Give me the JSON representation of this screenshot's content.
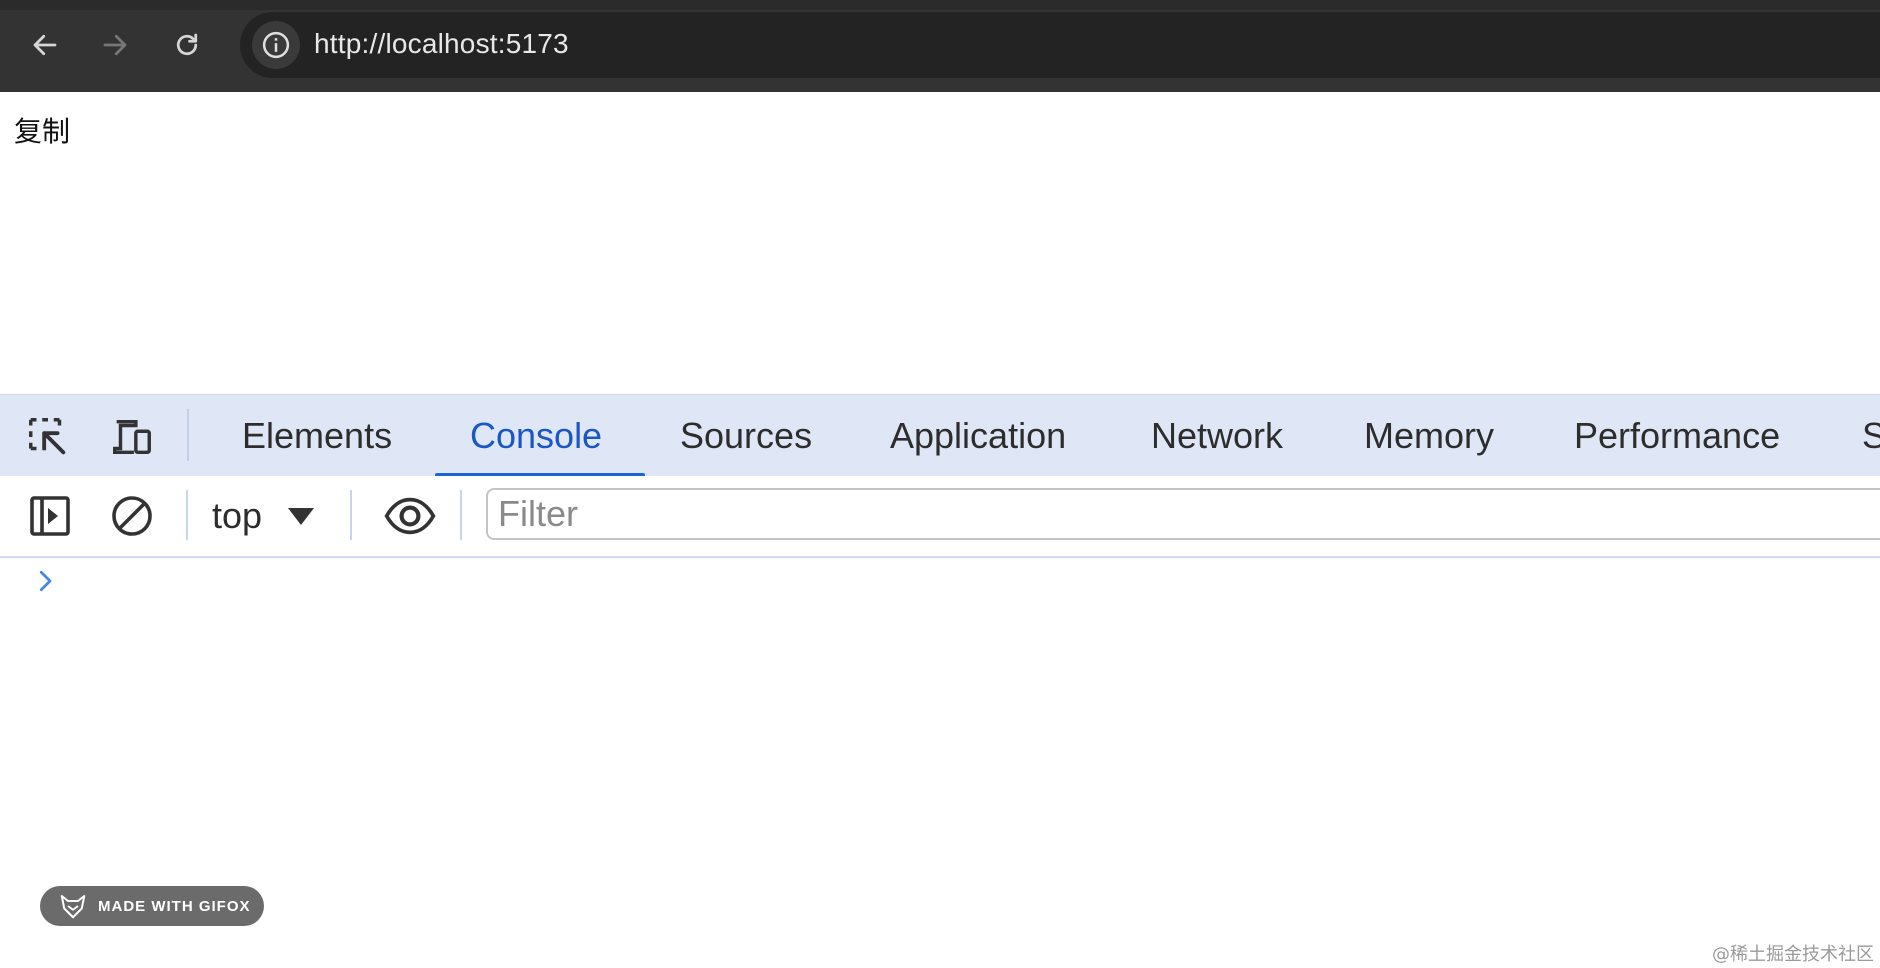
{
  "browser": {
    "url": "http://localhost:5173",
    "icons": [
      "back-arrow-icon",
      "forward-arrow-icon",
      "reload-icon",
      "info-icon"
    ]
  },
  "page": {
    "text": "复制"
  },
  "devtools": {
    "tabs": [
      {
        "label": "Elements"
      },
      {
        "label": "Console"
      },
      {
        "label": "Sources"
      },
      {
        "label": "Application"
      },
      {
        "label": "Network"
      },
      {
        "label": "Memory"
      },
      {
        "label": "Performance"
      },
      {
        "label": "S"
      }
    ],
    "active_tab": "Console",
    "console": {
      "context": "top",
      "filter_placeholder": "Filter",
      "filter_value": ""
    },
    "accent_color": "#1a65d8"
  },
  "overlay": {
    "badge": "MADE WITH GIFOX",
    "watermark": "@稀土掘金技术社区"
  }
}
